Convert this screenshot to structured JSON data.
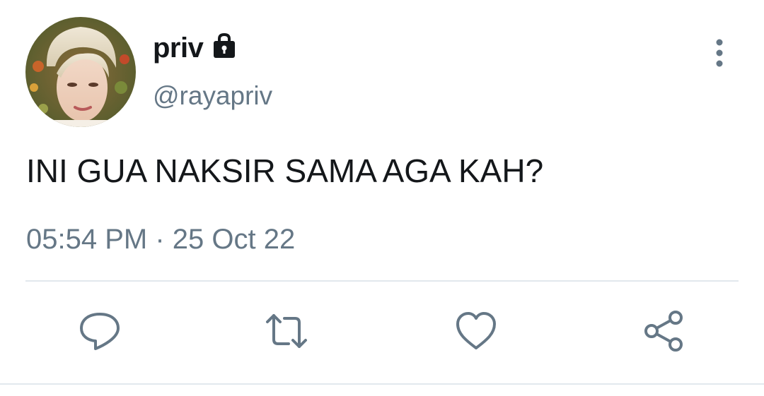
{
  "tweet": {
    "display_name": "priv",
    "handle": "@rayapriv",
    "text": "INI GUA NAKSIR SAMA AGA KAH?",
    "time": "05:54 PM",
    "separator": "·",
    "date": "25 Oct 22",
    "meta_line": "05:54 PM · 25 Oct 22"
  },
  "icons": {
    "lock": "lock-icon",
    "more": "more-vertical-icon",
    "reply": "reply-icon",
    "retweet": "retweet-icon",
    "like": "heart-icon",
    "share": "share-icon"
  },
  "colors": {
    "text_primary": "#14171a",
    "text_secondary": "#657786",
    "divider": "#e1e8ed",
    "background": "#ffffff"
  }
}
